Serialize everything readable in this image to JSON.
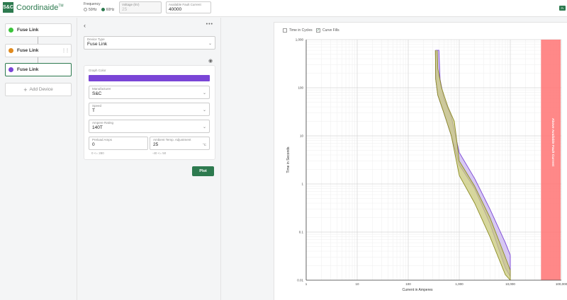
{
  "app": {
    "logo_mark": "S&C",
    "name": "Coordinaide",
    "trademark": "TM"
  },
  "topbar": {
    "frequency_label": "Frequency",
    "freq_50": "50Hz",
    "freq_60": "60Hz",
    "freq_selected": "60Hz",
    "voltage_label": "Voltage (kV)",
    "voltage_value": "25",
    "fault_current_label": "Available Fault Current",
    "fault_current_value": "40000",
    "corner_button": "Pr"
  },
  "devices": {
    "items": [
      {
        "label": "Fuse Link",
        "color": "#3cc43c"
      },
      {
        "label": "Fuse Link",
        "color": "#e08a1e"
      },
      {
        "label": "Fuse Link",
        "color": "#7a45d6"
      }
    ],
    "add_label": "Add Device"
  },
  "properties": {
    "device_type_label": "Device Type",
    "device_type_value": "Fuse Link",
    "graph_color_label": "Graph Color",
    "graph_color": "#7a45d6",
    "manufacturer_label": "Manufacturer",
    "manufacturer_value": "S&C",
    "speed_label": "Speed",
    "speed_value": "T",
    "ampere_rating_label": "Ampere Rating",
    "ampere_rating_value": "140T",
    "preload_label": "Preload Amps",
    "preload_value": "0",
    "preload_hint": "0 <= 280",
    "ambient_label": "Ambient Temp. Adjustment",
    "ambient_value": "25",
    "ambient_unit": "°C",
    "ambient_hint": "-40 <= 50",
    "plot_label": "Plot"
  },
  "chart_controls": {
    "time_in_cycles": "Time in Cycles",
    "time_in_cycles_checked": false,
    "curve_fills": "Curve Fills",
    "curve_fills_checked": true
  },
  "chart_data": {
    "type": "line",
    "scale": "log-log",
    "xlabel": "Current in Amperes",
    "ylabel": "Time in Seconds",
    "x_ticks": [
      "1",
      "10",
      "100",
      "1,000",
      "10,000",
      "100,000"
    ],
    "y_ticks": [
      "1,000",
      "100",
      "10",
      "1",
      "0.1",
      "0.01"
    ],
    "xlim": [
      1,
      100000
    ],
    "ylim": [
      0.01,
      1000
    ],
    "grid": true,
    "fault_band": {
      "label": "Above Available Fault Current",
      "from": 40000,
      "to": 100000,
      "color": "#ff7b7b"
    },
    "series": [
      {
        "color": "#7a45d6",
        "fill": "#c9b6ef",
        "upper": [
          [
            340,
            600
          ],
          [
            400,
            600
          ],
          [
            420,
            150
          ],
          [
            500,
            60
          ],
          [
            700,
            25
          ],
          [
            1000,
            4.5
          ],
          [
            2000,
            1.3
          ],
          [
            4000,
            0.3
          ],
          [
            8000,
            0.06
          ],
          [
            10000,
            0.033
          ]
        ],
        "lower": [
          [
            340,
            600
          ],
          [
            345,
            150
          ],
          [
            380,
            70
          ],
          [
            500,
            30
          ],
          [
            700,
            10
          ],
          [
            1000,
            2.5
          ],
          [
            2000,
            0.8
          ],
          [
            4000,
            0.15
          ],
          [
            8000,
            0.018
          ],
          [
            10000,
            0.012
          ]
        ]
      },
      {
        "color": "#8d8d24",
        "fill": "#c9c97d",
        "upper": [
          [
            370,
            600
          ],
          [
            380,
            250
          ],
          [
            450,
            100
          ],
          [
            600,
            40
          ],
          [
            800,
            20
          ],
          [
            1000,
            3
          ],
          [
            2000,
            0.9
          ],
          [
            4000,
            0.2
          ],
          [
            8000,
            0.03
          ],
          [
            10000,
            0.016
          ]
        ],
        "lower": [
          [
            340,
            600
          ],
          [
            345,
            150
          ],
          [
            380,
            70
          ],
          [
            500,
            30
          ],
          [
            700,
            10
          ],
          [
            1000,
            1.5
          ],
          [
            2000,
            0.4
          ],
          [
            4000,
            0.08
          ],
          [
            8000,
            0.013
          ],
          [
            10000,
            0.01
          ]
        ]
      }
    ]
  }
}
